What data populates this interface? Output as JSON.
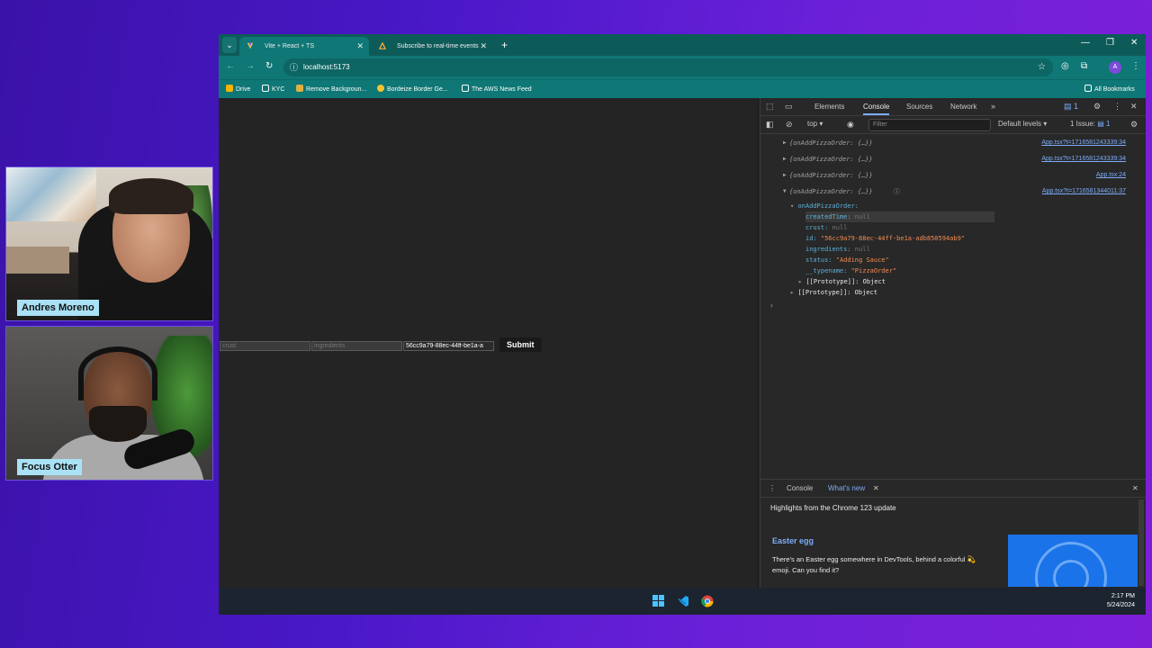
{
  "webcams": [
    {
      "name": "Andres Moreno"
    },
    {
      "name": "Focus Otter"
    }
  ],
  "browser": {
    "tabs": [
      {
        "label": "Vite + React + TS",
        "active": true
      },
      {
        "label": "Subscribe to real-time events",
        "active": false
      }
    ],
    "new_tab_icon": "+",
    "address": "localhost:5173",
    "bookmarks": [
      {
        "label": "Drive",
        "color": "#f4b400"
      },
      {
        "label": "KYC",
        "color": "#ffffff"
      },
      {
        "label": "Remove Backgroun...",
        "color": "#e0b040"
      },
      {
        "label": "Bordeize Border Ge...",
        "color": "#f4c430"
      },
      {
        "label": "The AWS News Feed",
        "color": "#ffffff"
      }
    ],
    "all_bookmarks": "All Bookmarks",
    "avatar_letter": "A"
  },
  "page": {
    "crust_placeholder": "crust",
    "ingredients_placeholder": "ingredients",
    "id_value": "56cc9a79-88ec-44ff-be1a-a",
    "submit_label": "Submit"
  },
  "devtools": {
    "tabs": [
      "Elements",
      "Console",
      "Sources",
      "Network"
    ],
    "active_tab": "Console",
    "issue_badge": "1",
    "context": "top",
    "filter_placeholder": "Filter",
    "levels": "Default levels",
    "issues": "1 Issue:",
    "issues_count": "1",
    "logs": [
      {
        "text": "{onAddPizzaOrder: {…}}",
        "source": "App.tsx?t=1716581243339:34"
      },
      {
        "text": "{onAddPizzaOrder: {…}}",
        "source": "App.tsx?t=1716581243339:34"
      },
      {
        "text": "{onAddPizzaOrder: {…}}",
        "source": "App.tsx:24"
      },
      {
        "text": "{onAddPizzaOrder: {…}}",
        "source": "App.tsx?t=1716581344011:37"
      }
    ],
    "expanded": {
      "root_key": "onAddPizzaOrder:",
      "props": [
        {
          "key": "createdTime",
          "value": "null",
          "type": "null"
        },
        {
          "key": "crust",
          "value": "null",
          "type": "null"
        },
        {
          "key": "id",
          "value": "\"56cc9a79-88ec-44ff-be1a-adb850594ab9\"",
          "type": "string"
        },
        {
          "key": "ingredients",
          "value": "null",
          "type": "null"
        },
        {
          "key": "status",
          "value": "\"Adding Sauce\"",
          "type": "string"
        },
        {
          "key": "__typename",
          "value": "\"PizzaOrder\"",
          "type": "string"
        }
      ],
      "inner_proto": "[[Prototype]]: Object",
      "outer_proto": "[[Prototype]]: Object"
    },
    "drawer": {
      "tabs": [
        "Console",
        "What's new"
      ],
      "active_tab": "What's new",
      "highlights": "Highlights from the Chrome 123 update",
      "egg_title": "Easter egg",
      "egg_text": "There's an Easter egg somewhere in DevTools, behind a colorful 💫 emoji. Can you find it?"
    }
  },
  "taskbar": {
    "time": "2:17 PM",
    "date": "5/24/2024"
  },
  "colors": {
    "tab_bar": "#0d5b59",
    "toolbar": "#0f7775",
    "devtools_bg": "#282828",
    "link": "#7cacf8"
  }
}
